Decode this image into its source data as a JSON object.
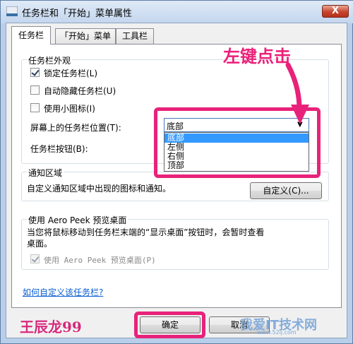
{
  "window": {
    "title": "任务栏和「开始」菜单属性",
    "close_label": "X"
  },
  "tabs": [
    {
      "label": "任务栏"
    },
    {
      "label": "「开始」菜单"
    },
    {
      "label": "工具栏"
    }
  ],
  "appearance": {
    "group_title": "任务栏外观",
    "lock": {
      "label": "锁定任务栏(L)",
      "checked": true
    },
    "autohide": {
      "label": "自动隐藏任务栏(U)",
      "checked": false
    },
    "small_icons": {
      "label": "使用小图标(I)",
      "checked": false
    },
    "position_label": "屏幕上的任务栏位置(T):",
    "position_value": "底部",
    "position_options": [
      "底部",
      "左侧",
      "右侧",
      "顶部"
    ],
    "buttons_label": "任务栏按钮(B):"
  },
  "notification": {
    "group_title": "通知区域",
    "description": "自定义通知区域中出现的图标和通知。",
    "customize_label": "自定义(C)..."
  },
  "aero_peek": {
    "group_title": "使用 Aero Peek 预览桌面",
    "description_line1": "当您将鼠标移动到任务栏末端的“显示桌面”按钮时，会暂时查看",
    "description_line2": "桌面。",
    "checkbox_label": "使用 Aero Peek 预览桌面(P)",
    "checked": true
  },
  "help_link": "如何自定义该任务栏?",
  "buttons": {
    "ok": "确定",
    "cancel": "取消"
  },
  "annotations": {
    "callout": "左键点击",
    "author": "王辰龙99",
    "watermark": "我爱IT技术网",
    "watermark_url": "www.52ij.com",
    "color": "#e8227a"
  }
}
